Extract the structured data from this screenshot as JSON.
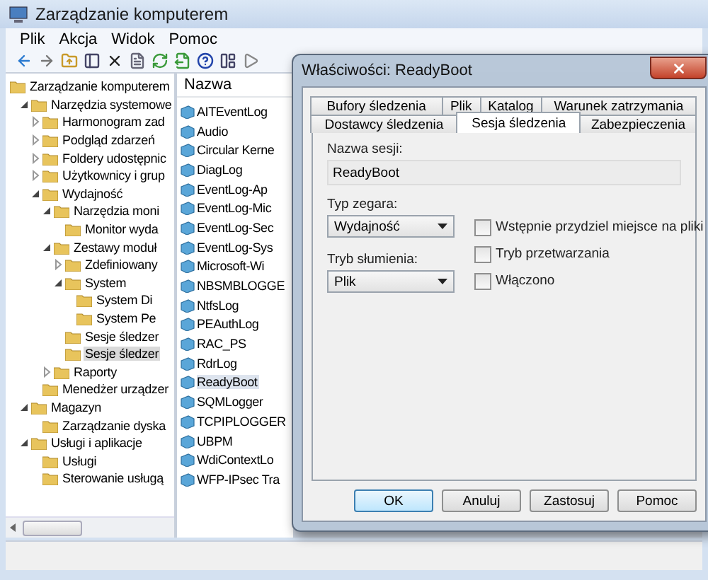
{
  "window": {
    "title": "Zarządzanie komputerem"
  },
  "menu": [
    "Plik",
    "Akcja",
    "Widok",
    "Pomoc"
  ],
  "tree": [
    {
      "label": "Zarządzanie komputerem",
      "selected": false,
      "children": [
        {
          "label": "Narzędzia systemowe",
          "expanded": true,
          "selected": false,
          "children": [
            {
              "label": "Harmonogram zad",
              "expanded": false,
              "selected": false
            },
            {
              "label": "Podgląd zdarzeń",
              "expanded": false,
              "selected": false
            },
            {
              "label": "Foldery udostępnic",
              "expanded": false,
              "selected": false
            },
            {
              "label": "Użytkownicy i grup",
              "expanded": false,
              "selected": false
            },
            {
              "label": "Wydajność",
              "expanded": true,
              "selected": false,
              "children": [
                {
                  "label": "Narzędzia moni",
                  "expanded": true,
                  "selected": false,
                  "children": [
                    {
                      "label": "Monitor wyda",
                      "selected": false
                    }
                  ]
                },
                {
                  "label": "Zestawy moduł",
                  "expanded": true,
                  "selected": false,
                  "children": [
                    {
                      "label": "Zdefiniowany",
                      "expanded": false,
                      "selected": false
                    },
                    {
                      "label": "System",
                      "expanded": true,
                      "selected": false,
                      "children": [
                        {
                          "label": "System Di",
                          "selected": false
                        },
                        {
                          "label": "System Pe",
                          "selected": false
                        }
                      ]
                    },
                    {
                      "label": "Sesje śledzer",
                      "selected": false
                    },
                    {
                      "label": "Sesje śledzer",
                      "selected": true
                    }
                  ]
                },
                {
                  "label": "Raporty",
                  "expanded": false,
                  "selected": false
                }
              ]
            },
            {
              "label": "Menedżer urządzer",
              "selected": false
            }
          ]
        },
        {
          "label": "Magazyn",
          "expanded": true,
          "selected": false,
          "children": [
            {
              "label": "Zarządzanie dyska",
              "selected": false
            }
          ]
        },
        {
          "label": "Usługi i aplikacje",
          "expanded": true,
          "selected": false,
          "children": [
            {
              "label": "Usługi",
              "selected": false
            },
            {
              "label": "Sterowanie usługą",
              "selected": false
            }
          ]
        }
      ]
    }
  ],
  "list": {
    "column": "Nazwa",
    "items": [
      {
        "name": "AITEventLog",
        "selected": false
      },
      {
        "name": "Audio",
        "selected": false
      },
      {
        "name": "Circular Kerne",
        "selected": false
      },
      {
        "name": "DiagLog",
        "selected": false
      },
      {
        "name": "EventLog-Ap",
        "selected": false
      },
      {
        "name": "EventLog-Mic",
        "selected": false
      },
      {
        "name": "EventLog-Sec",
        "selected": false
      },
      {
        "name": "EventLog-Sys",
        "selected": false
      },
      {
        "name": "Microsoft-Wi",
        "selected": false
      },
      {
        "name": "NBSMBLOGGE",
        "selected": false
      },
      {
        "name": "NtfsLog",
        "selected": false
      },
      {
        "name": "PEAuthLog",
        "selected": false
      },
      {
        "name": "RAC_PS",
        "selected": false
      },
      {
        "name": "RdrLog",
        "selected": false
      },
      {
        "name": "ReadyBoot",
        "selected": true
      },
      {
        "name": "SQMLogger",
        "selected": false
      },
      {
        "name": "TCPIPLOGGER",
        "selected": false
      },
      {
        "name": "UBPM",
        "selected": false
      },
      {
        "name": "WdiContextLo",
        "selected": false
      },
      {
        "name": "WFP-IPsec Tra",
        "selected": false
      }
    ]
  },
  "dialog": {
    "title": "Właściwości: ReadyBoot",
    "tab_rows": [
      [
        {
          "label": "Bufory śledzenia",
          "selected": false
        },
        {
          "label": "Plik",
          "selected": false
        },
        {
          "label": "Katalog",
          "selected": false
        },
        {
          "label": "Warunek zatrzymania",
          "selected": false
        }
      ],
      [
        {
          "label": "Dostawcy śledzenia",
          "selected": false
        },
        {
          "label": "Sesja śledzenia",
          "selected": true
        },
        {
          "label": "Zabezpieczenia",
          "selected": false
        }
      ]
    ],
    "session_name": {
      "label": "Nazwa sesji:",
      "value": "ReadyBoot"
    },
    "clock_type": {
      "label": "Typ zegara:",
      "value": "Wydajność"
    },
    "stream_mode": {
      "label": "Tryb słumienia:",
      "value": "Plik"
    },
    "checkboxes": [
      {
        "label": "Wstępnie przydziel miejsce na pliki",
        "checked": false
      },
      {
        "label": "Tryb przetwarzania",
        "checked": false
      },
      {
        "label": "Włączono",
        "checked": false
      }
    ],
    "buttons": [
      {
        "label": "OK",
        "default": true
      },
      {
        "label": "Anuluj",
        "default": false
      },
      {
        "label": "Zastosuj",
        "default": false
      },
      {
        "label": "Pomoc",
        "default": false
      }
    ]
  }
}
